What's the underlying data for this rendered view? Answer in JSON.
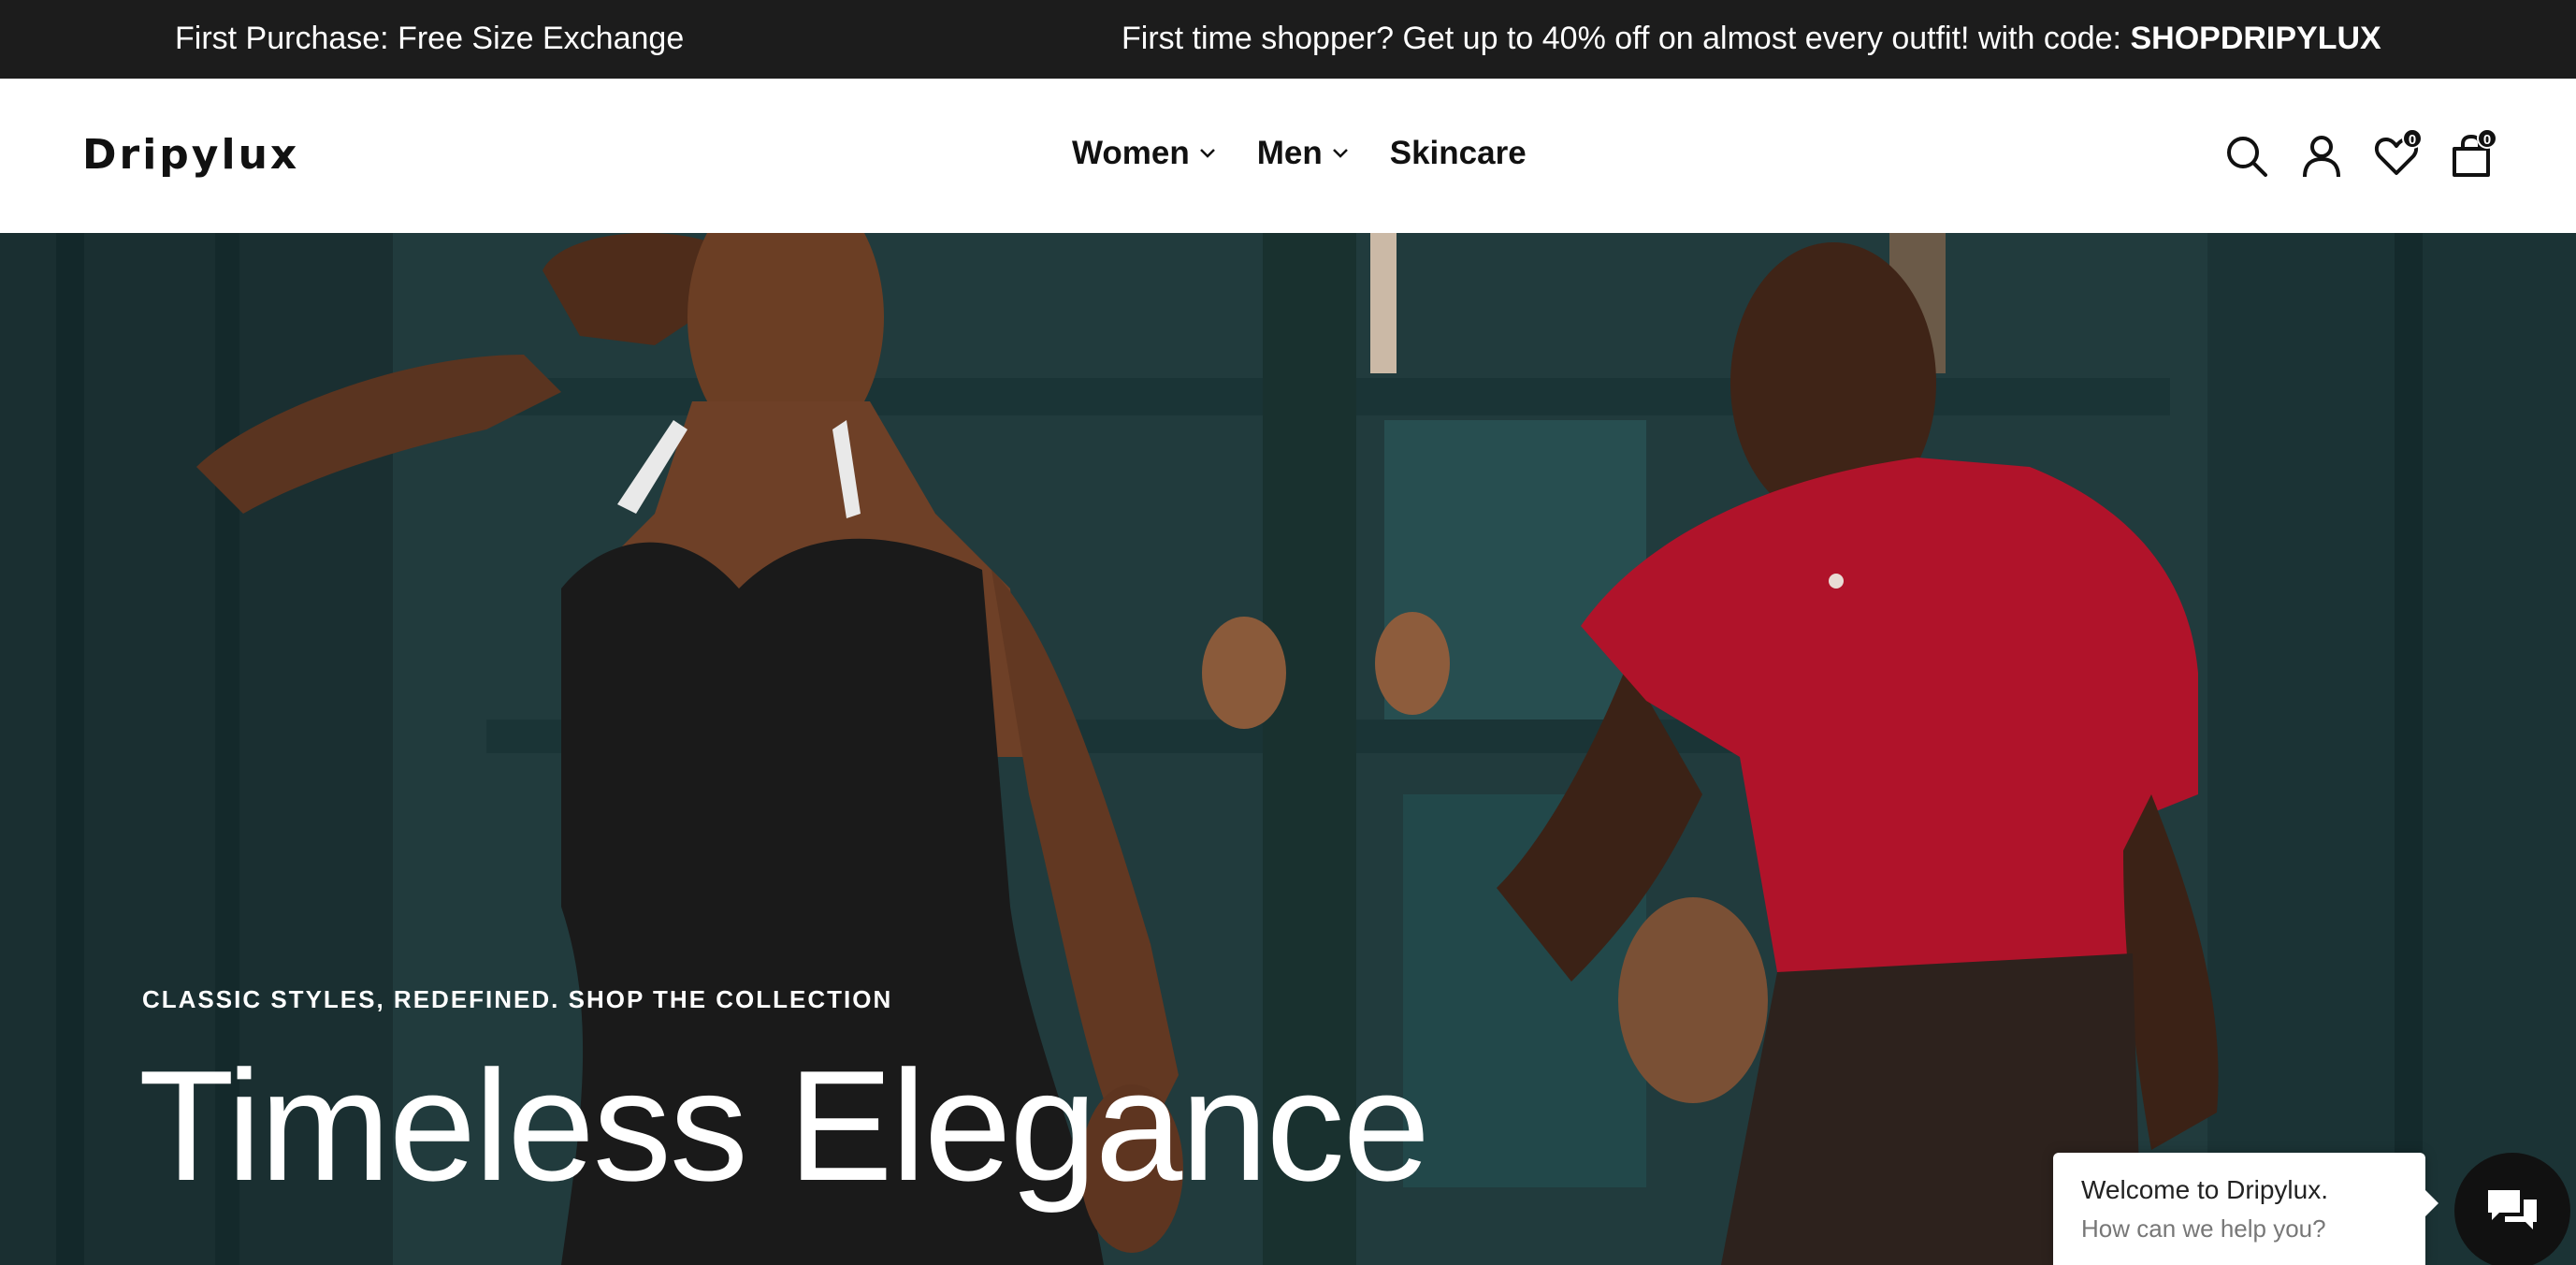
{
  "announcement": {
    "left": "First Purchase: Free Size Exchange",
    "right_prefix": "First time shopper? Get up to 40% off on almost every outfit! with code: ",
    "right_code": "SHOPDRIPYLUX"
  },
  "header": {
    "logo": "Dripylux",
    "nav": [
      {
        "label": "Women",
        "has_dropdown": true
      },
      {
        "label": "Men",
        "has_dropdown": true
      },
      {
        "label": "Skincare",
        "has_dropdown": false
      }
    ],
    "icons": [
      "search-icon",
      "account-icon",
      "wishlist-icon",
      "cart-icon"
    ],
    "wishlist_count": "0",
    "cart_count": "0"
  },
  "hero": {
    "eyebrow": "CLASSIC STYLES, REDEFINED. SHOP THE COLLECTION",
    "title": "Timeless Elegance"
  },
  "chat": {
    "title": "Welcome to Dripylux.",
    "subtitle": "How can we help you?"
  },
  "colors": {
    "announcement_bg": "#1c1c1c",
    "hero_bg": "#244446",
    "dress": "#1a1a1a",
    "polo": "#b0132a"
  }
}
